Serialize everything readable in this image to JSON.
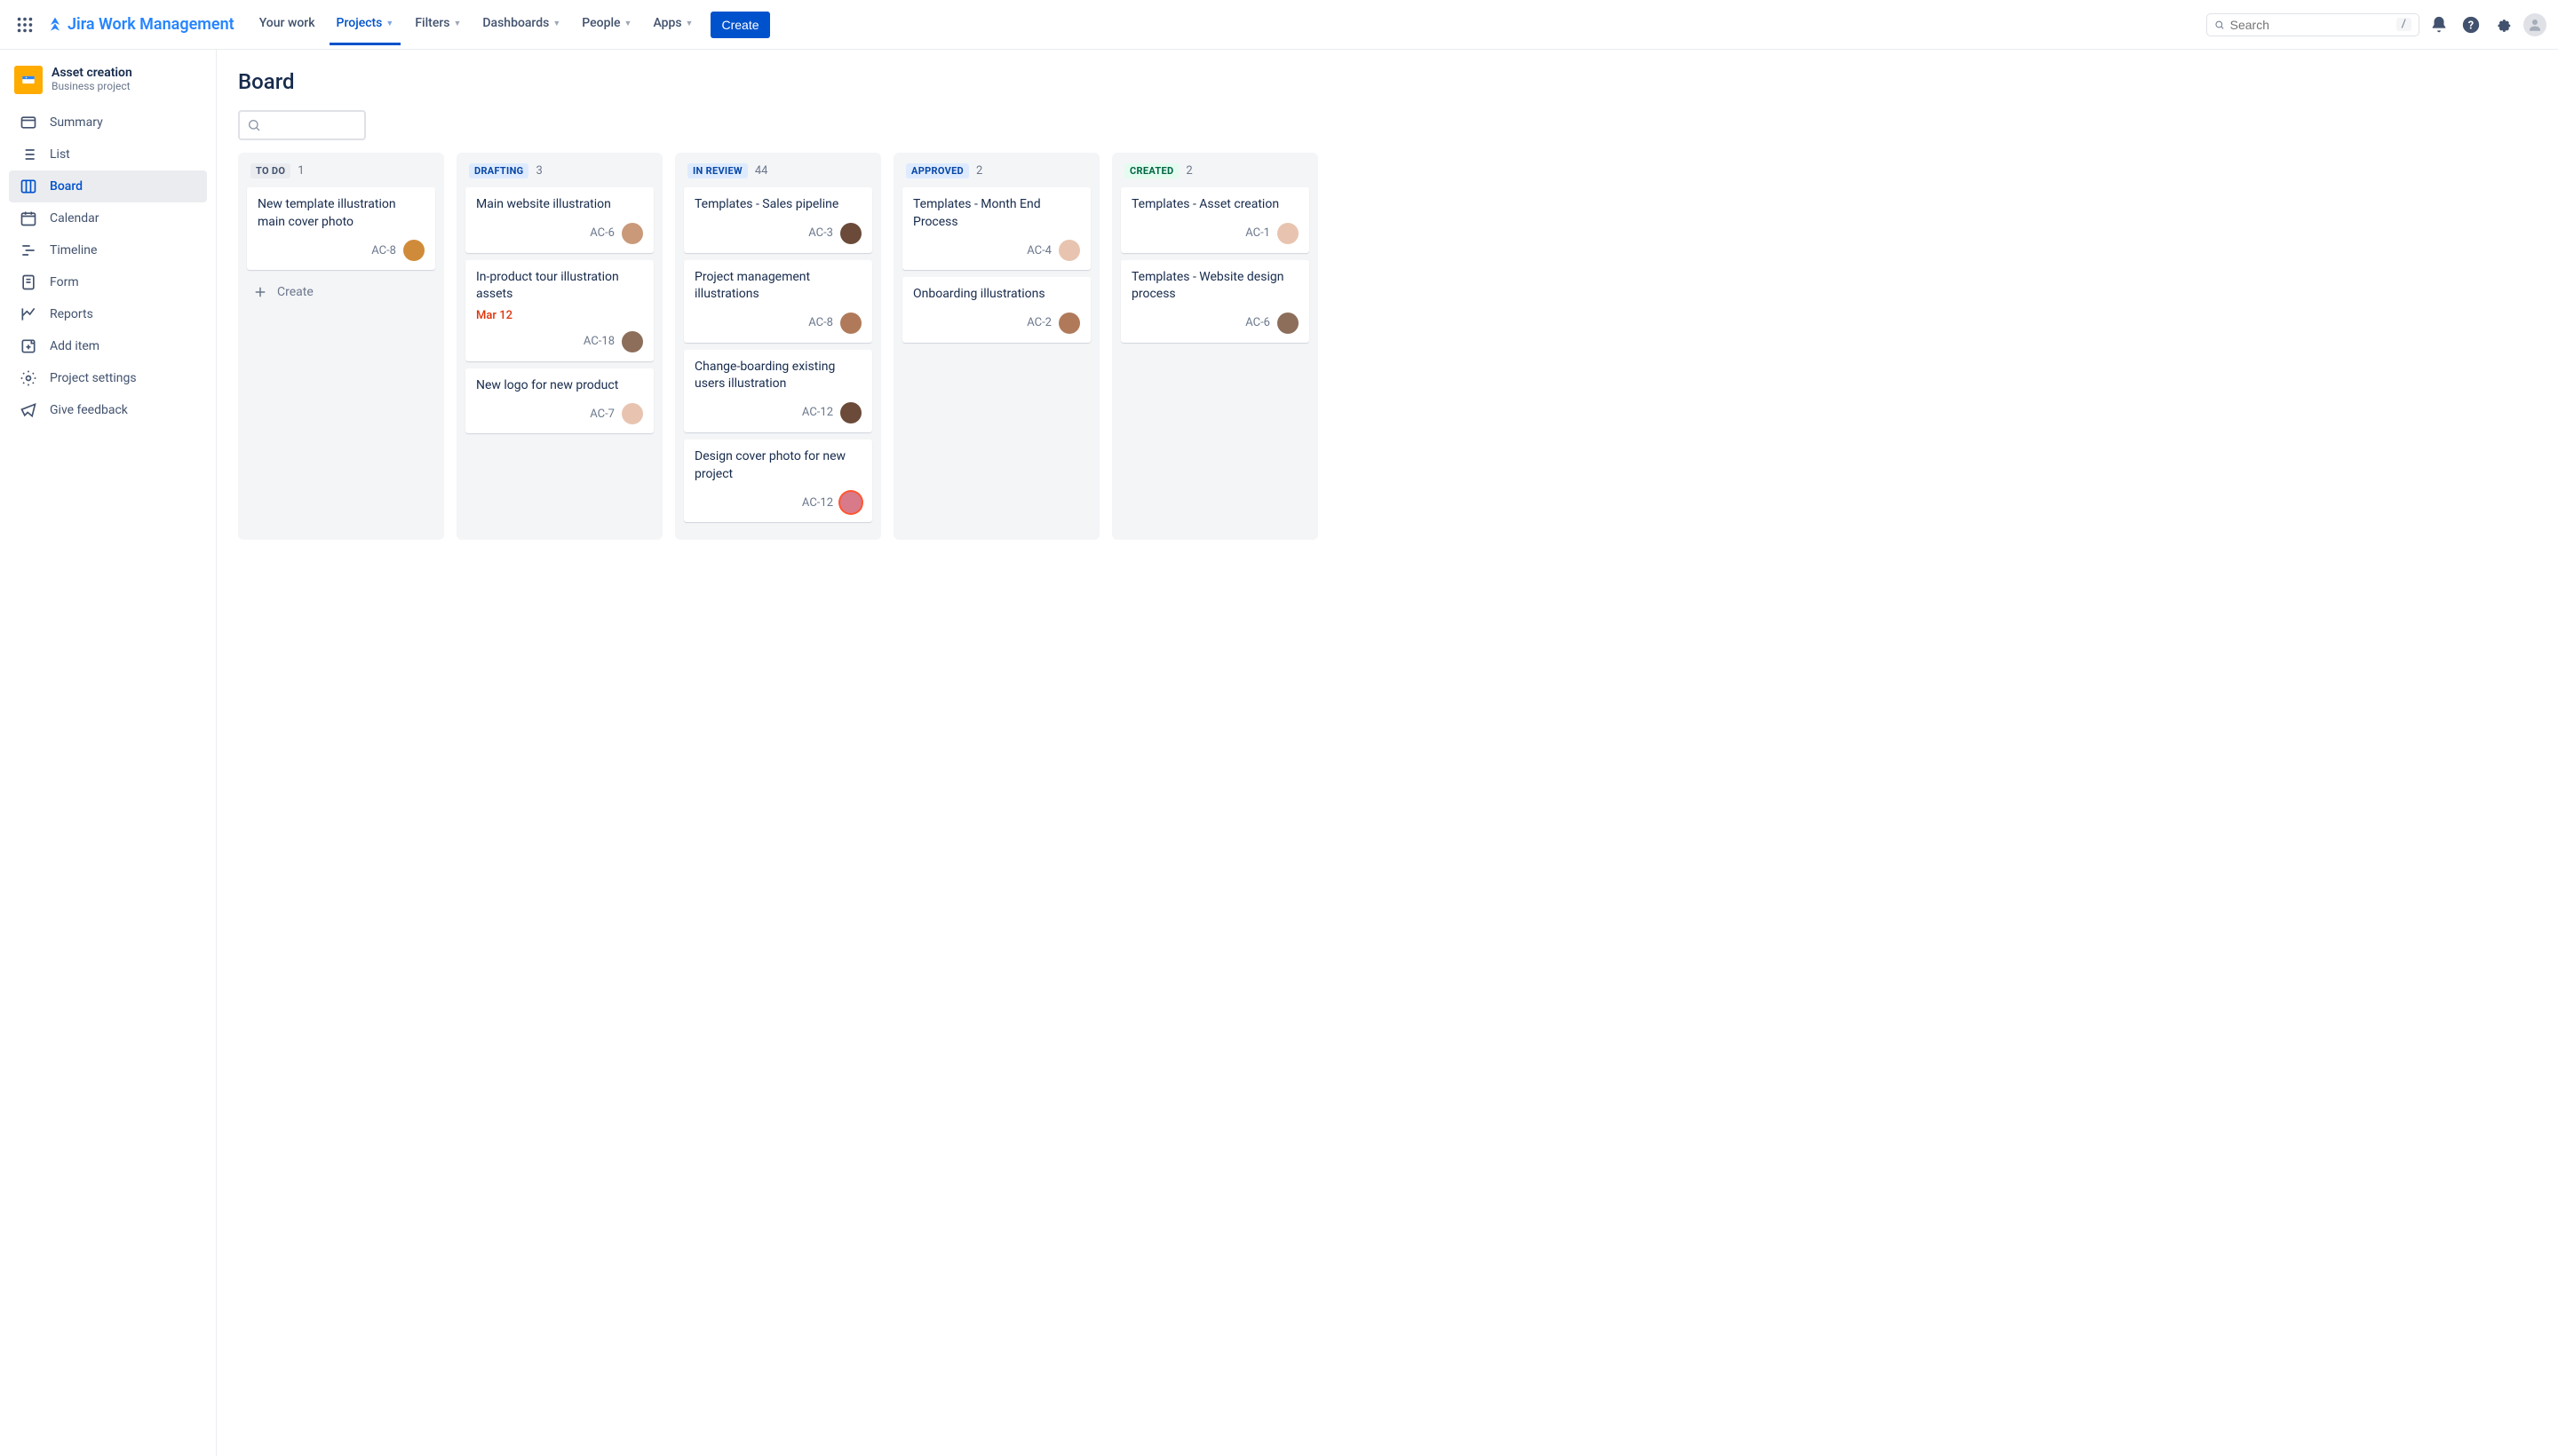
{
  "app_name": "Jira Work Management",
  "nav": {
    "your_work": "Your work",
    "projects": "Projects",
    "filters": "Filters",
    "dashboards": "Dashboards",
    "people": "People",
    "apps": "Apps"
  },
  "create_label": "Create",
  "search_placeholder": "Search",
  "search_key": "/",
  "project": {
    "name": "Asset creation",
    "subtitle": "Business project"
  },
  "sidebar": {
    "summary": "Summary",
    "list": "List",
    "board": "Board",
    "calendar": "Calendar",
    "timeline": "Timeline",
    "form": "Form",
    "reports": "Reports",
    "add_item": "Add item",
    "project_settings": "Project settings",
    "give_feedback": "Give feedback"
  },
  "page_title": "Board",
  "create_card_label": "Create",
  "columns": [
    {
      "label": "TO DO",
      "count": "1",
      "label_bg": "#EBECF0",
      "label_color": "#42526E",
      "show_create": true,
      "cards": [
        {
          "title": "New template illustration main cover photo",
          "key": "AC-8",
          "avatar": "#D08B3A"
        }
      ]
    },
    {
      "label": "DRAFTING",
      "count": "3",
      "label_bg": "#DEEBFF",
      "label_color": "#0747A6",
      "cards": [
        {
          "title": "Main website illustration",
          "key": "AC-6",
          "avatar": "#C9997A"
        },
        {
          "title": "In-product tour illustration assets",
          "due": "Mar 12",
          "key": "AC-18",
          "avatar": "#8C6E5A"
        },
        {
          "title": "New logo for new product",
          "key": "AC-7",
          "avatar": "#E8C4B0"
        }
      ]
    },
    {
      "label": "IN REVIEW",
      "count": "44",
      "label_bg": "#DEEBFF",
      "label_color": "#0747A6",
      "cards": [
        {
          "title": "Templates - Sales pipeline",
          "key": "AC-3",
          "avatar": "#6B4A3A"
        },
        {
          "title": "Project management illustrations",
          "key": "AC-8",
          "avatar": "#B07A5A"
        },
        {
          "title": "Change-boarding existing users illustration",
          "key": "AC-12",
          "avatar": "#6B4A3A"
        },
        {
          "title": "Design cover photo for new project",
          "key": "AC-12",
          "avatar": "#D87A8A",
          "avatar_ring": "#FF5630"
        }
      ]
    },
    {
      "label": "APPROVED",
      "count": "2",
      "label_bg": "#DEEBFF",
      "label_color": "#0747A6",
      "cards": [
        {
          "title": "Templates - Month End Process",
          "key": "AC-4",
          "avatar": "#E8C4B0"
        },
        {
          "title": "Onboarding illustrations",
          "key": "AC-2",
          "avatar": "#B07A5A"
        }
      ]
    },
    {
      "label": "CREATED",
      "count": "2",
      "label_bg": "#E3FCEF",
      "label_color": "#006644",
      "cards": [
        {
          "title": "Templates - Asset creation",
          "key": "AC-1",
          "avatar": "#E8C4B0"
        },
        {
          "title": "Templates - Website design process",
          "key": "AC-6",
          "avatar": "#8C6E5A"
        }
      ]
    }
  ]
}
